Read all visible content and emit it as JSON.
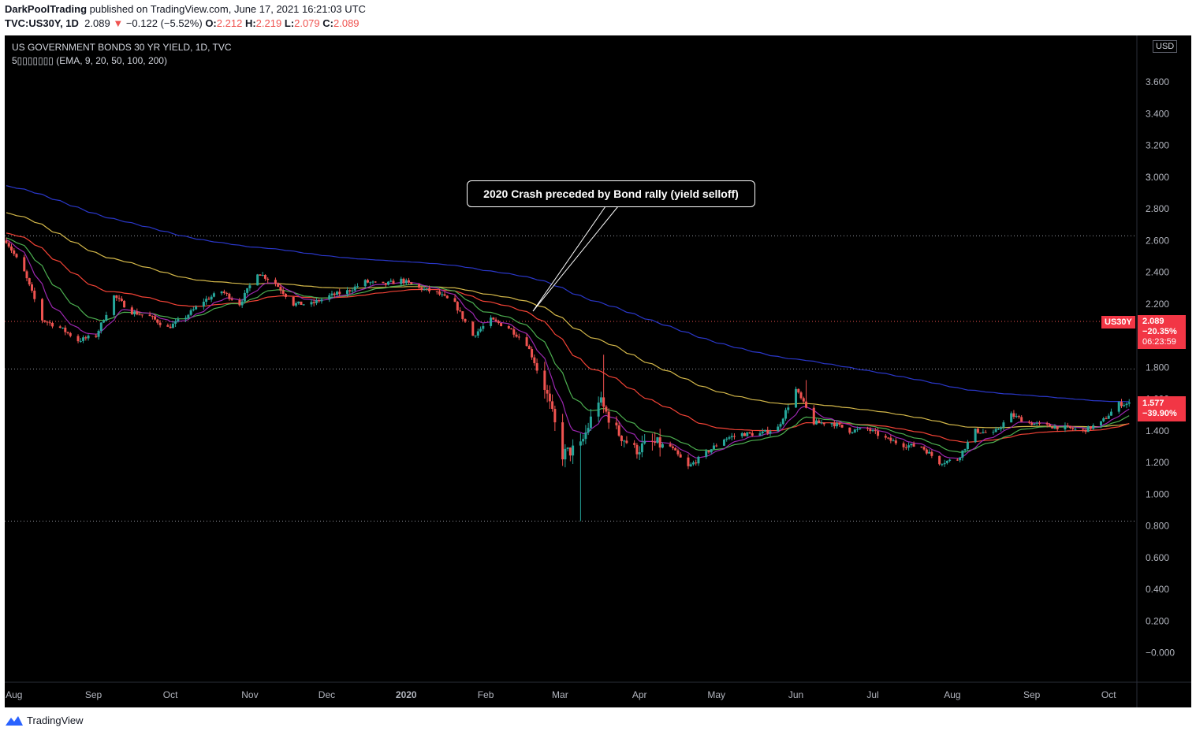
{
  "header": {
    "author": "DarkPoolTrading",
    "published_text": " published on TradingView.com, June 17, 2021 16:21:03 UTC",
    "symbol": "TVC:US30Y, 1D",
    "last": "2.089",
    "arrow": "▼",
    "change": "−0.122 (−5.52%)",
    "o_label": "O:",
    "o_value": "2.212",
    "h_label": "H:",
    "h_value": "2.219",
    "l_label": "L:",
    "l_value": "2.079",
    "c_label": "C:",
    "c_value": "2.089"
  },
  "legend": {
    "title": "US GOVERNMENT BONDS 30 YR YIELD, 1D, TVC",
    "indicator": "5▯▯▯▯▯▯▯ (EMA, 9, 20, 50, 100, 200)"
  },
  "currency": "USD",
  "annotation": "2020 Crash preceded by Bond rally (yield selloff)",
  "price_tags": {
    "symbol": "US30Y",
    "current": "2.089",
    "current_pct": "−20.35%",
    "countdown": "06:23:59",
    "second": "1.577",
    "second_pct": "−39.90%"
  },
  "footer": {
    "brand": "TradingView"
  },
  "colors": {
    "up": "#26a69a",
    "down": "#ef5350",
    "ema9": "#9c27b0",
    "ema20": "#4caf50",
    "ema50": "#f44336",
    "ema100": "#d4b84a",
    "ema200": "#2a37c9"
  },
  "chart_data": {
    "type": "candlestick",
    "title": "US GOVERNMENT BONDS 30 YR YIELD, 1D, TVC",
    "y_ticks": [
      "3.",
      "3.600",
      "3.400",
      "3.200",
      "3.000",
      "2.800",
      "2.600",
      "2.400",
      "2.200",
      "1.800",
      "1.600",
      "1.400",
      "1.200",
      "1.000",
      "0.800",
      "0.600",
      "0.400",
      "0.200",
      "−0.000"
    ],
    "x_ticks": [
      "Aug",
      "Sep",
      "Oct",
      "Nov",
      "Dec",
      "2020",
      "Feb",
      "Mar",
      "Apr",
      "May",
      "Jun",
      "Jul",
      "Aug",
      "Sep",
      "Oct"
    ],
    "horizontal_levels": [
      2.63,
      2.09,
      1.79,
      0.83
    ],
    "close_anchors": [
      [
        "2019-07-29",
        2.6
      ],
      [
        "2019-08-05",
        2.4
      ],
      [
        "2019-08-12",
        2.1
      ],
      [
        "2019-08-19",
        2.05
      ],
      [
        "2019-08-26",
        1.97
      ],
      [
        "2019-09-02",
        2.0
      ],
      [
        "2019-09-09",
        2.25
      ],
      [
        "2019-09-16",
        2.15
      ],
      [
        "2019-09-23",
        2.12
      ],
      [
        "2019-09-30",
        2.05
      ],
      [
        "2019-10-07",
        2.12
      ],
      [
        "2019-10-14",
        2.22
      ],
      [
        "2019-10-21",
        2.28
      ],
      [
        "2019-10-28",
        2.2
      ],
      [
        "2019-11-04",
        2.4
      ],
      [
        "2019-11-11",
        2.33
      ],
      [
        "2019-11-18",
        2.2
      ],
      [
        "2019-11-25",
        2.2
      ],
      [
        "2019-12-02",
        2.25
      ],
      [
        "2019-12-09",
        2.28
      ],
      [
        "2019-12-16",
        2.34
      ],
      [
        "2019-12-23",
        2.32
      ],
      [
        "2019-12-30",
        2.35
      ],
      [
        "2020-01-06",
        2.3
      ],
      [
        "2020-01-13",
        2.27
      ],
      [
        "2020-01-20",
        2.2
      ],
      [
        "2020-01-27",
        2.0
      ],
      [
        "2020-02-03",
        2.1
      ],
      [
        "2020-02-10",
        2.05
      ],
      [
        "2020-02-17",
        1.95
      ],
      [
        "2020-02-24",
        1.68
      ],
      [
        "2020-03-02",
        1.25
      ],
      [
        "2020-03-09",
        1.3
      ],
      [
        "2020-03-16",
        1.6
      ],
      [
        "2020-03-23",
        1.4
      ],
      [
        "2020-03-30",
        1.28
      ],
      [
        "2020-04-06",
        1.32
      ],
      [
        "2020-04-13",
        1.3
      ],
      [
        "2020-04-20",
        1.17
      ],
      [
        "2020-04-27",
        1.26
      ],
      [
        "2020-05-04",
        1.35
      ],
      [
        "2020-05-11",
        1.38
      ],
      [
        "2020-05-18",
        1.38
      ],
      [
        "2020-05-25",
        1.42
      ],
      [
        "2020-06-01",
        1.66
      ],
      [
        "2020-06-08",
        1.45
      ],
      [
        "2020-06-15",
        1.45
      ],
      [
        "2020-06-22",
        1.4
      ],
      [
        "2020-06-29",
        1.41
      ],
      [
        "2020-07-06",
        1.35
      ],
      [
        "2020-07-13",
        1.31
      ],
      [
        "2020-07-20",
        1.3
      ],
      [
        "2020-07-27",
        1.2
      ],
      [
        "2020-08-03",
        1.22
      ],
      [
        "2020-08-10",
        1.4
      ],
      [
        "2020-08-17",
        1.38
      ],
      [
        "2020-08-24",
        1.5
      ],
      [
        "2020-08-31",
        1.45
      ],
      [
        "2020-09-07",
        1.43
      ],
      [
        "2020-09-14",
        1.42
      ],
      [
        "2020-09-21",
        1.4
      ],
      [
        "2020-09-28",
        1.45
      ],
      [
        "2020-10-05",
        1.57
      ]
    ]
  }
}
